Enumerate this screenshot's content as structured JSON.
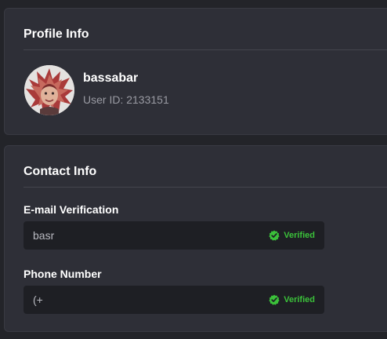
{
  "profile": {
    "title": "Profile Info",
    "username": "bassabar",
    "user_id": "User ID: 2133151",
    "avatar_icon": "user-avatar-image"
  },
  "contact": {
    "title": "Contact Info",
    "email": {
      "label": "E-mail Verification",
      "value": "basr",
      "status": "Verified",
      "status_icon": "verified-badge-icon"
    },
    "phone": {
      "label": "Phone Number",
      "value": "(+",
      "status": "Verified",
      "status_icon": "verified-badge-icon"
    }
  },
  "colors": {
    "background": "#232429",
    "card": "#2e2f37",
    "field": "#1e1f24",
    "verified": "#3bc13a",
    "muted_text": "#9a9ba3"
  }
}
